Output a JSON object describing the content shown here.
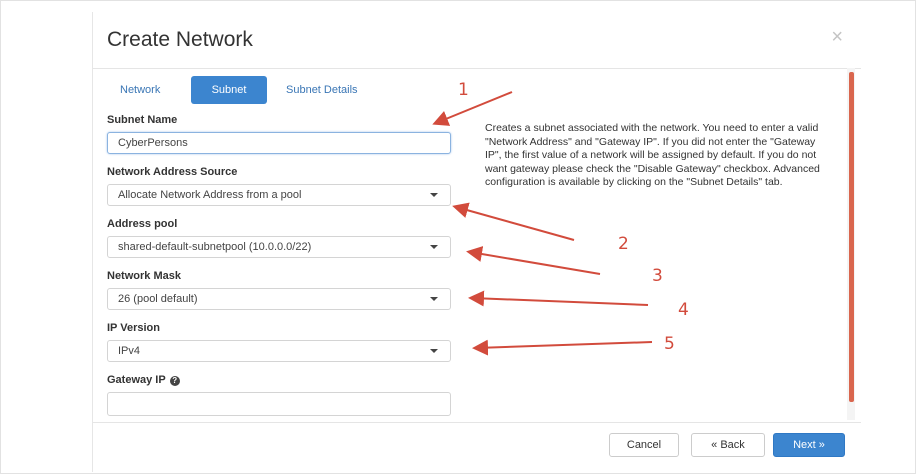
{
  "modal": {
    "title": "Create Network",
    "close_glyph": "×"
  },
  "tabs": [
    {
      "label": "Network",
      "active": false
    },
    {
      "label": "Subnet",
      "active": true
    },
    {
      "label": "Subnet Details",
      "active": false
    }
  ],
  "form": {
    "subnet_name": {
      "label": "Subnet Name",
      "value": "CyberPersons"
    },
    "network_address_source": {
      "label": "Network Address Source",
      "selected": "Allocate Network Address from a pool"
    },
    "address_pool": {
      "label": "Address pool",
      "selected": "shared-default-subnetpool (10.0.0.0/22)"
    },
    "network_mask": {
      "label": "Network Mask",
      "selected": "26 (pool default)"
    },
    "ip_version": {
      "label": "IP Version",
      "selected": "IPv4"
    },
    "gateway_ip": {
      "label": "Gateway IP",
      "value": "",
      "help_icon": "question-circle-icon",
      "help_glyph": "?"
    }
  },
  "description": "Creates a subnet associated with the network. You need to enter a valid \"Network Address\" and \"Gateway IP\". If you did not enter the \"Gateway IP\", the first value of a network will be assigned by default. If you do not want gateway please check the \"Disable Gateway\" checkbox. Advanced configuration is available by clicking on the \"Subnet Details\" tab.",
  "footer": {
    "cancel_label": "Cancel",
    "back_label": "« Back",
    "next_label": "Next »"
  },
  "annotations": [
    "1",
    "2",
    "3",
    "4",
    "5"
  ],
  "colors": {
    "primary": "#3c85cf",
    "annotation": "#d24b3c",
    "scrollbar": "#d9664e"
  }
}
